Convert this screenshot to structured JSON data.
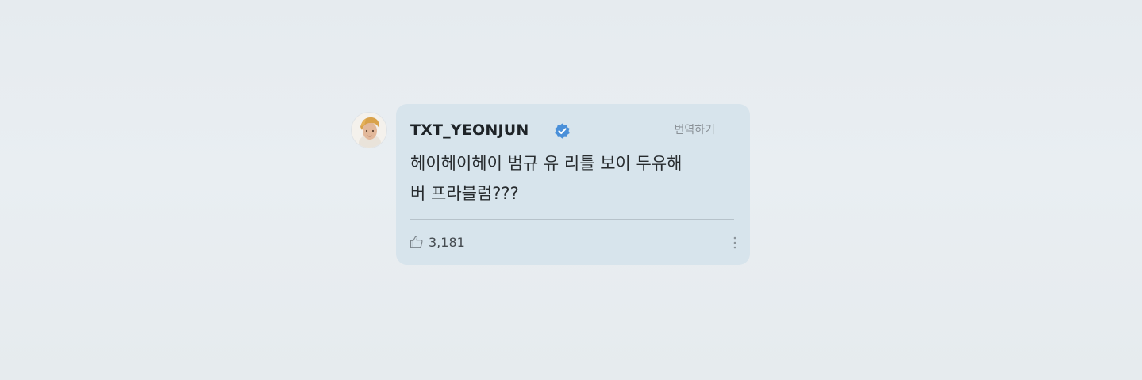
{
  "post": {
    "username": "TXT_YEONJUN",
    "translate_label": "번역하기",
    "message_line1": "헤이헤이헤이 범규 유 리틀 보이 두유해",
    "message_line2": "버 프라블럼???",
    "like_count": "3,181"
  },
  "icons": {
    "verified": "verified-badge-icon",
    "like": "thumbs-up-icon",
    "more": "more-options-icon"
  },
  "colors": {
    "card_background": "#d7e4ec",
    "page_background": "#e8edf1",
    "verified_blue": "#4a90d9",
    "username_text": "#1e2327",
    "translate_text": "#8a9197"
  }
}
